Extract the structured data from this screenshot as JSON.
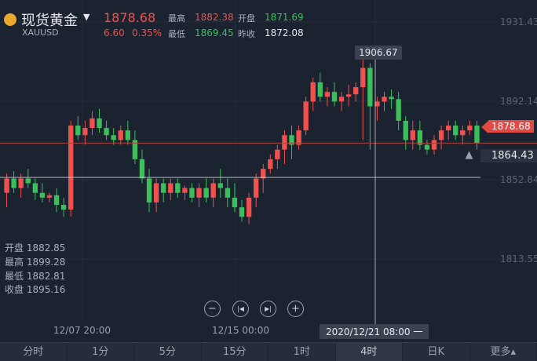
{
  "header": {
    "title": "现货黄金",
    "symbol": "XAUUSD",
    "price": "1878.68",
    "change": "6.60",
    "change_pct": "0.35%",
    "high_label": "最高",
    "high_value": "1882.38",
    "open_label": "开盘",
    "open_value": "1871.69",
    "low_label": "最低",
    "low_value": "1869.45",
    "prev_close_label": "昨收",
    "prev_close_value": "1872.08"
  },
  "ohlc_panel": {
    "open": "开盘 1882.85",
    "high": "最高 1899.28",
    "low": "最低 1882.81",
    "close": "收盘 1895.16"
  },
  "price_tags": {
    "peak": "1906.67",
    "current": "1878.68",
    "crosshair": "1864.43",
    "crosshair_time": "2020/12/21 08:00 一"
  },
  "x_ticks": [
    "12/07 20:00",
    "12/15 00:00"
  ],
  "y_ticks": [
    "1931.43",
    "1892.14",
    "1852.84",
    "1813.55"
  ],
  "controls": {
    "zoom_out": "−",
    "prev": "|◀",
    "next": "▶|",
    "zoom_in": "+"
  },
  "tabs": [
    {
      "label": "分时"
    },
    {
      "label": "1分"
    },
    {
      "label": "5分"
    },
    {
      "label": "15分"
    },
    {
      "label": "1时"
    },
    {
      "label": "4时"
    },
    {
      "label": "日K"
    },
    {
      "label": "更多▴"
    }
  ],
  "colors": {
    "up": "#f0514c",
    "down": "#3cbf5a",
    "bg": "#1b2230",
    "accent": "#f0514c"
  },
  "chart_data": {
    "type": "candlestick",
    "ylim": [
      1805,
      1935
    ],
    "series": [
      {
        "name": "",
        "values": [
          [
            1858,
            1866,
            1852,
            1864
          ],
          [
            1864,
            1867,
            1858,
            1860
          ],
          [
            1860,
            1866,
            1856,
            1864
          ],
          [
            1864,
            1868,
            1860,
            1862
          ],
          [
            1862,
            1864,
            1855,
            1858
          ],
          [
            1858,
            1862,
            1854,
            1856
          ],
          [
            1856,
            1858,
            1854,
            1857
          ],
          [
            1857,
            1860,
            1850,
            1853
          ],
          [
            1853,
            1856,
            1848,
            1851
          ],
          [
            1851,
            1888,
            1848,
            1886
          ],
          [
            1886,
            1890,
            1880,
            1882
          ],
          [
            1882,
            1888,
            1878,
            1885
          ],
          [
            1885,
            1892,
            1882,
            1889
          ],
          [
            1889,
            1893,
            1883,
            1885
          ],
          [
            1885,
            1888,
            1880,
            1882
          ],
          [
            1882,
            1885,
            1878,
            1880
          ],
          [
            1880,
            1886,
            1878,
            1884
          ],
          [
            1884,
            1888,
            1878,
            1880
          ],
          [
            1880,
            1884,
            1870,
            1872
          ],
          [
            1872,
            1876,
            1862,
            1864
          ],
          [
            1864,
            1868,
            1850,
            1854
          ],
          [
            1854,
            1864,
            1850,
            1862
          ],
          [
            1862,
            1864,
            1854,
            1858
          ],
          [
            1858,
            1864,
            1855,
            1862
          ],
          [
            1862,
            1864,
            1856,
            1858
          ],
          [
            1858,
            1861,
            1855,
            1860
          ],
          [
            1860,
            1862,
            1854,
            1856
          ],
          [
            1856,
            1862,
            1852,
            1860
          ],
          [
            1860,
            1864,
            1854,
            1856
          ],
          [
            1856,
            1864,
            1852,
            1862
          ],
          [
            1862,
            1868,
            1856,
            1860
          ],
          [
            1860,
            1864,
            1852,
            1856
          ],
          [
            1856,
            1862,
            1850,
            1852
          ],
          [
            1852,
            1855,
            1846,
            1848
          ],
          [
            1848,
            1858,
            1845,
            1856
          ],
          [
            1856,
            1866,
            1852,
            1864
          ],
          [
            1864,
            1870,
            1858,
            1868
          ],
          [
            1868,
            1874,
            1866,
            1872
          ],
          [
            1872,
            1878,
            1868,
            1876
          ],
          [
            1876,
            1884,
            1870,
            1882
          ],
          [
            1882,
            1886,
            1872,
            1878
          ],
          [
            1878,
            1886,
            1876,
            1884
          ],
          [
            1884,
            1898,
            1882,
            1896
          ],
          [
            1896,
            1906,
            1892,
            1904
          ],
          [
            1904,
            1908,
            1896,
            1898
          ],
          [
            1898,
            1902,
            1894,
            1900
          ],
          [
            1900,
            1904,
            1894,
            1896
          ],
          [
            1896,
            1900,
            1892,
            1898
          ],
          [
            1898,
            1903,
            1894,
            1899
          ],
          [
            1899,
            1904,
            1896,
            1902
          ],
          [
            1902,
            1914,
            1880,
            1910
          ],
          [
            1910,
            1912,
            1876,
            1894
          ],
          [
            1894,
            1898,
            1888,
            1896
          ],
          [
            1896,
            1900,
            1892,
            1898
          ],
          [
            1898,
            1901,
            1893,
            1897
          ],
          [
            1897,
            1900,
            1884,
            1888
          ],
          [
            1888,
            1890,
            1876,
            1880
          ],
          [
            1880,
            1888,
            1876,
            1884
          ],
          [
            1884,
            1888,
            1876,
            1878
          ],
          [
            1878,
            1880,
            1874,
            1876
          ],
          [
            1876,
            1882,
            1874,
            1880
          ],
          [
            1880,
            1886,
            1876,
            1884
          ],
          [
            1884,
            1888,
            1880,
            1886
          ],
          [
            1886,
            1888,
            1880,
            1882
          ],
          [
            1882,
            1886,
            1878,
            1884
          ],
          [
            1884,
            1888,
            1882,
            1886
          ],
          [
            1886,
            1888,
            1876,
            1878.68
          ]
        ]
      }
    ]
  }
}
